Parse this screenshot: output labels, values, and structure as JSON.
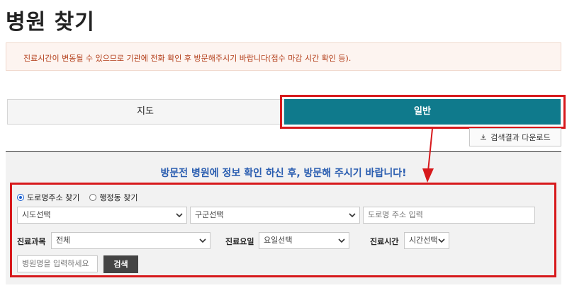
{
  "page": {
    "title": "병원 찾기"
  },
  "notice": {
    "text": "진료시간이 변동될 수 있으므로 기관에 전화 확인 후 방문해주시기 바랍니다(접수 마감 시간 확인 등)."
  },
  "tabs": [
    {
      "label": "지도",
      "active": false
    },
    {
      "label": "일반",
      "active": true
    }
  ],
  "download": {
    "label": "검색결과 다운로드",
    "icon": "download-icon"
  },
  "guide": {
    "text": "방문전 병원에 정보 확인 하신 후, 방문해 주시기 바랍니다!"
  },
  "search": {
    "radio_options": [
      {
        "label": "도로명주소 찾기",
        "checked": true
      },
      {
        "label": "행정동 찾기",
        "checked": false
      }
    ],
    "city_select": "시도선택",
    "district_select": "구군선택",
    "road_address_placeholder": "도로명 주소 입력",
    "department_label": "진료과목",
    "department_value": "전체",
    "day_label": "진료요일",
    "day_value": "요일선택",
    "time_label": "진료시간",
    "time_value": "시간선택",
    "hospital_name_placeholder": "병원명을 입력하세요",
    "search_button": "검색"
  },
  "colors": {
    "accent": "#0f7a8c",
    "highlight": "#d7191c",
    "guide": "#2a5db0",
    "notice_text": "#b23c17"
  }
}
